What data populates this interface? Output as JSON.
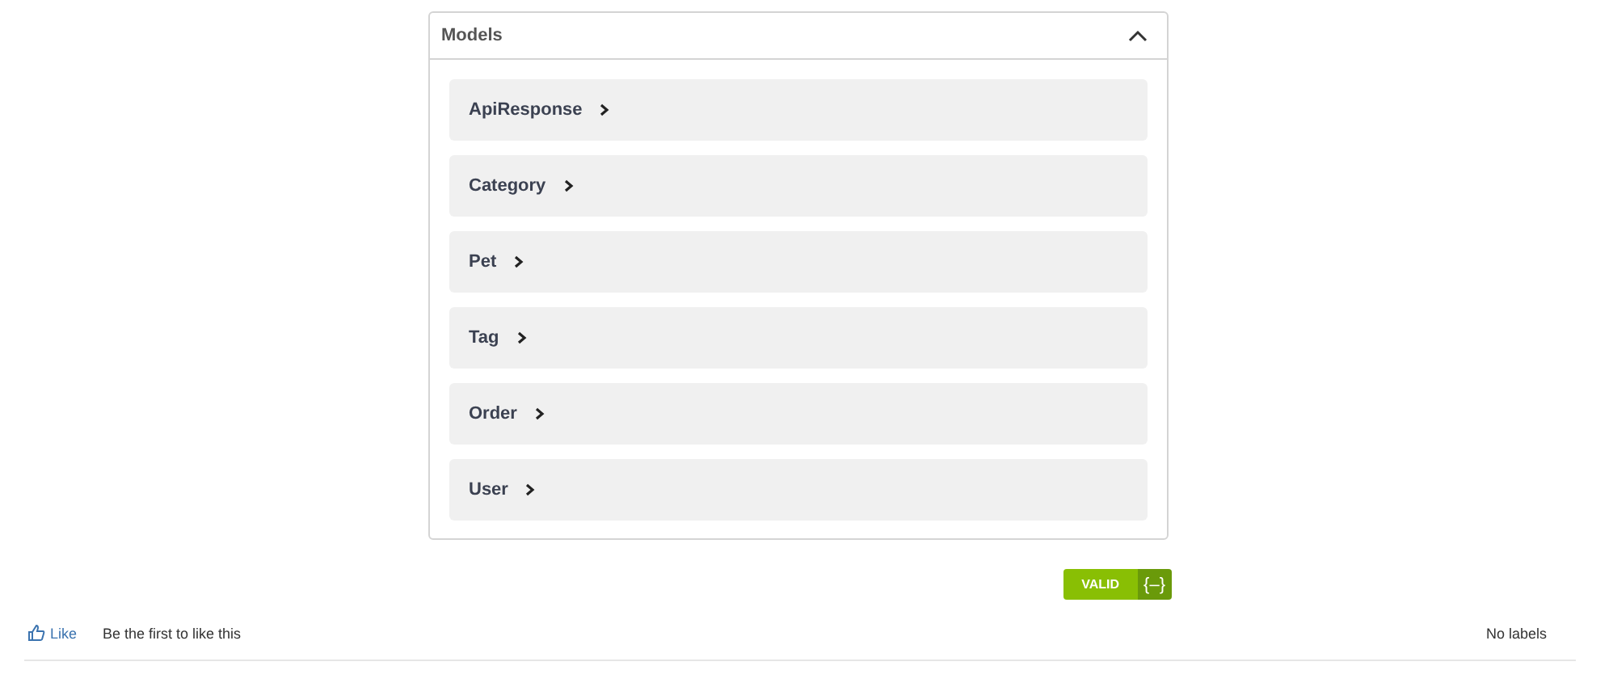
{
  "models_panel": {
    "title": "Models",
    "expanded": true,
    "models": [
      {
        "name": "ApiResponse",
        "expanded": false
      },
      {
        "name": "Category",
        "expanded": false
      },
      {
        "name": "Pet",
        "expanded": false
      },
      {
        "name": "Tag",
        "expanded": false
      },
      {
        "name": "Order",
        "expanded": false
      },
      {
        "name": "User",
        "expanded": false
      }
    ]
  },
  "validator_badge": {
    "status": "VALID",
    "symbol": "{–}"
  },
  "footer": {
    "like_link": "Like",
    "like_summary": "Be the first to like this",
    "labels": "No labels"
  }
}
